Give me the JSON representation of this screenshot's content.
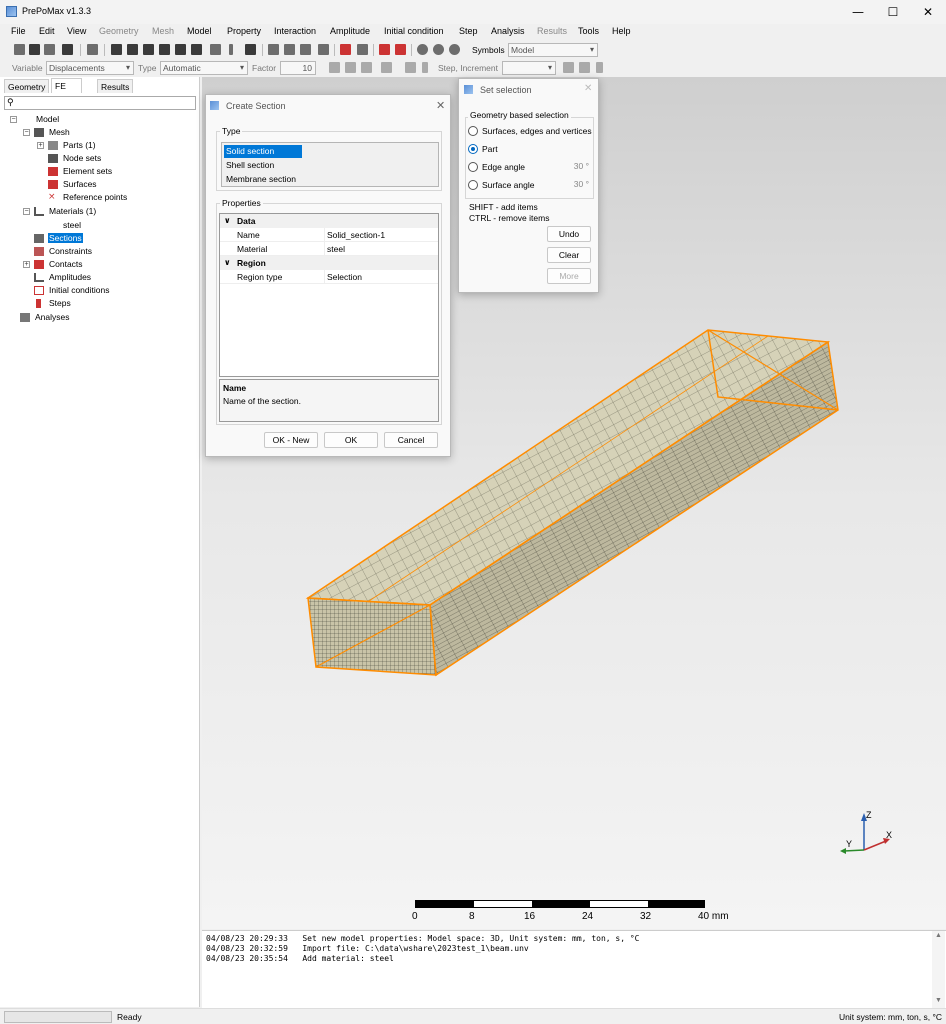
{
  "window": {
    "title": "PrePoMax v1.3.3"
  },
  "menu": [
    "File",
    "Edit",
    "View",
    "Geometry",
    "Mesh",
    "Model",
    "Property",
    "Interaction",
    "Amplitude",
    "Initial condition",
    "Step",
    "Analysis",
    "Results",
    "Tools",
    "Help"
  ],
  "menu_disabled": [
    "Geometry",
    "Mesh",
    "Results"
  ],
  "toolbar": {
    "symbols_label": "Symbols",
    "symbols_value": "Model"
  },
  "toolbar2": {
    "variable_label": "Variable",
    "variable_value": "Displacements",
    "type_label": "Type",
    "type_value": "Automatic",
    "factor_label": "Factor",
    "factor_value": "10",
    "step_label": "Step, Increment"
  },
  "tabs": [
    "Geometry",
    "FE Model",
    "Results"
  ],
  "tree": {
    "model": "Model",
    "mesh": "Mesh",
    "parts": "Parts (1)",
    "node_sets": "Node sets",
    "element_sets": "Element sets",
    "surfaces": "Surfaces",
    "reference_points": "Reference points",
    "materials": "Materials (1)",
    "steel": "steel",
    "sections": "Sections",
    "constraints": "Constraints",
    "contacts": "Contacts",
    "amplitudes": "Amplitudes",
    "initial_conditions": "Initial conditions",
    "steps": "Steps",
    "analyses": "Analyses"
  },
  "create_section": {
    "title": "Create Section",
    "type_label": "Type",
    "types": [
      "Solid section",
      "Shell section",
      "Membrane section"
    ],
    "selected_type": "Solid section",
    "properties_label": "Properties",
    "cat_data": "Data",
    "cat_region": "Region",
    "rows": [
      {
        "name": "Name",
        "value": "Solid_section-1"
      },
      {
        "name": "Material",
        "value": "steel"
      },
      {
        "name": "Region type",
        "value": "Selection"
      }
    ],
    "desc_title": "Name",
    "desc_text": "Name of the section.",
    "ok_new": "OK - New",
    "ok": "OK",
    "cancel": "Cancel"
  },
  "set_selection": {
    "title": "Set selection",
    "group_label": "Geometry based selection",
    "options": [
      "Surfaces, edges and vertices",
      "Part",
      "Edge angle",
      "Surface angle"
    ],
    "selected": "Part",
    "edge_angle": "30 °",
    "surface_angle": "30 °",
    "hint1": "SHIFT - add items",
    "hint2": "CTRL - remove items",
    "undo": "Undo",
    "clear": "Clear",
    "more": "More"
  },
  "scalebar": {
    "ticks": [
      "0",
      "8",
      "16",
      "24",
      "32",
      "40 mm"
    ]
  },
  "axes": {
    "x": "X",
    "y": "Y",
    "z": "Z"
  },
  "console": [
    "04/08/23 20:29:33   Set new model properties: Model space: 3D, Unit system: mm, ton, s, °C",
    "04/08/23 20:32:59   Import file: C:\\data\\wshare\\2023test_1\\beam.unv",
    "04/08/23 20:35:54   Add material: steel"
  ],
  "status": {
    "left": "Ready",
    "right": "Unit system: mm, ton, s, °C"
  },
  "colors": {
    "accent": "#0078d7",
    "edge": "#ff8c00",
    "beam": "#c9c4a8"
  }
}
